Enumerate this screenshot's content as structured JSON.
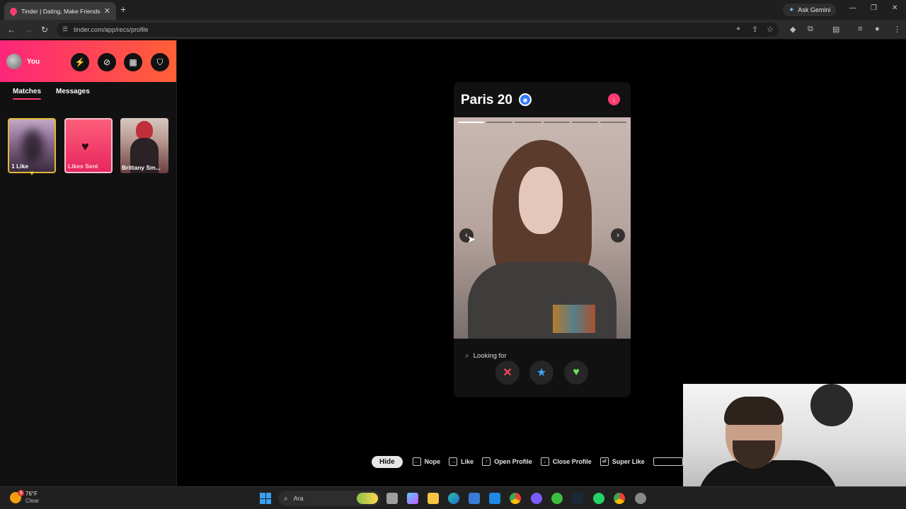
{
  "browser": {
    "tab_title": "Tinder | Dating, Make Friends &",
    "tab_close": "✕",
    "new_tab": "+",
    "ask_gemini": "Ask Gemini",
    "url": "tinder.com/app/recs/profile"
  },
  "sidebar": {
    "user_label": "You",
    "tabs": [
      {
        "label": "Matches",
        "active": true
      },
      {
        "label": "Messages",
        "active": false
      }
    ],
    "matches": [
      {
        "label": "1 Like"
      },
      {
        "label": "Likes Sent"
      },
      {
        "label": "Brittany Sm..."
      }
    ]
  },
  "profile": {
    "name_age": "Paris 20",
    "photo_count": 6,
    "current_photo": 1,
    "looking_for": "Looking for",
    "action_nope": "✕",
    "action_super": "★",
    "action_like": "♥"
  },
  "shortcuts": {
    "hide": "Hide",
    "items": [
      {
        "key": "←",
        "label": "Nope"
      },
      {
        "key": "→",
        "label": "Like"
      },
      {
        "key": "↑",
        "label": "Open Profile"
      },
      {
        "key": "↓",
        "label": "Close Profile"
      },
      {
        "key": "⏎",
        "label": "Super Like"
      }
    ]
  },
  "taskbar": {
    "temperature": "76°F",
    "condition": "Clear",
    "weather_badge": "3",
    "search_placeholder": "Ara"
  },
  "colors": {
    "brand_gradient_start": "#fd267a",
    "brand_gradient_end": "#ff6036",
    "nope": "#ff4458",
    "super_like": "#3ca4ff",
    "like": "#6be25a"
  }
}
